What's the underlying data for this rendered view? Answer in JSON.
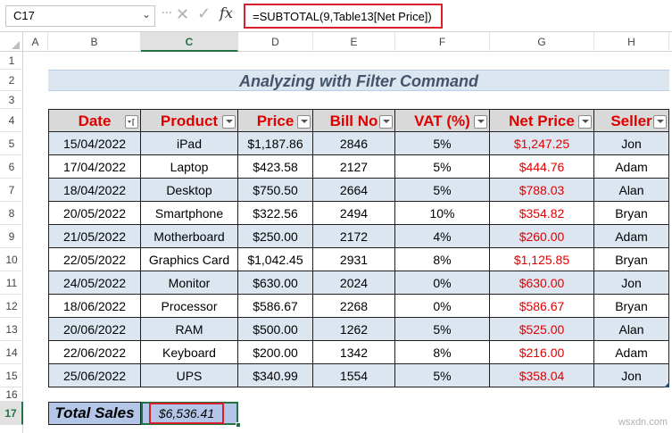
{
  "formula_bar": {
    "name_box": "C17",
    "formula": "=SUBTOTAL(9,Table13[Net Price])",
    "fx_label": "fx"
  },
  "columns": [
    "A",
    "B",
    "C",
    "D",
    "E",
    "F",
    "G",
    "H"
  ],
  "rows": [
    "1",
    "2",
    "3",
    "4",
    "5",
    "6",
    "7",
    "8",
    "9",
    "10",
    "11",
    "12",
    "13",
    "14",
    "15",
    "16",
    "17"
  ],
  "title": "Analyzing with Filter Command",
  "table": {
    "headers": [
      "Date",
      "Product",
      "Price",
      "Bill No",
      "VAT (%)",
      "Net Price",
      "Seller"
    ],
    "rows": [
      [
        "15/04/2022",
        "iPad",
        "$1,187.86",
        "2846",
        "5%",
        "$1,247.25",
        "Jon"
      ],
      [
        "17/04/2022",
        "Laptop",
        "$423.58",
        "2127",
        "5%",
        "$444.76",
        "Adam"
      ],
      [
        "18/04/2022",
        "Desktop",
        "$750.50",
        "2664",
        "5%",
        "$788.03",
        "Alan"
      ],
      [
        "20/05/2022",
        "Smartphone",
        "$322.56",
        "2494",
        "10%",
        "$354.82",
        "Bryan"
      ],
      [
        "21/05/2022",
        "Motherboard",
        "$250.00",
        "2172",
        "4%",
        "$260.00",
        "Adam"
      ],
      [
        "22/05/2022",
        "Graphics Card",
        "$1,042.45",
        "2931",
        "8%",
        "$1,125.85",
        "Bryan"
      ],
      [
        "24/05/2022",
        "Monitor",
        "$630.00",
        "2024",
        "0%",
        "$630.00",
        "Jon"
      ],
      [
        "18/06/2022",
        "Processor",
        "$586.67",
        "2268",
        "0%",
        "$586.67",
        "Bryan"
      ],
      [
        "20/06/2022",
        "RAM",
        "$500.00",
        "1262",
        "5%",
        "$525.00",
        "Alan"
      ],
      [
        "22/06/2022",
        "Keyboard",
        "$200.00",
        "1342",
        "8%",
        "$216.00",
        "Adam"
      ],
      [
        "25/06/2022",
        "UPS",
        "$340.99",
        "1554",
        "5%",
        "$358.04",
        "Jon"
      ]
    ]
  },
  "total": {
    "label": "Total Sales",
    "value": "$6,536.41"
  },
  "watermark": "wsxdn.com",
  "colors": {
    "header_text": "#e00000",
    "band_fill": "#dce6f1",
    "excel_green": "#217346",
    "highlight_red": "#d9202a"
  }
}
